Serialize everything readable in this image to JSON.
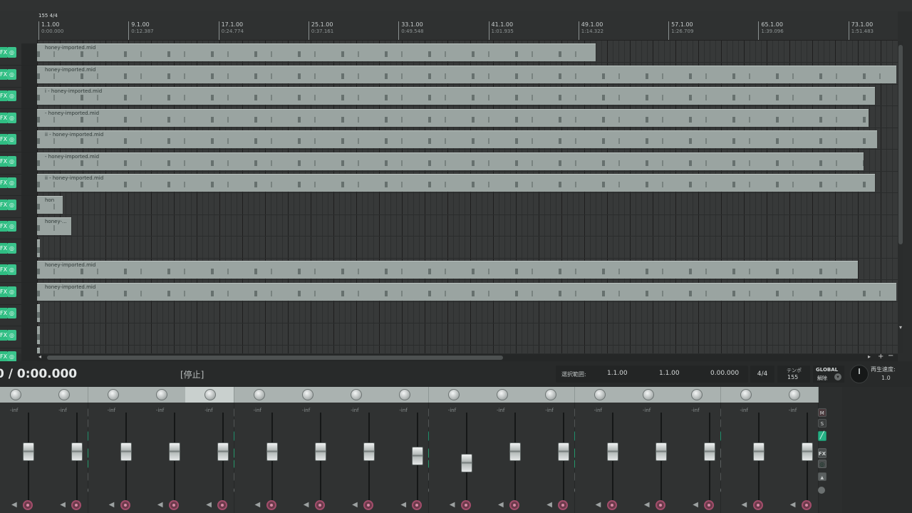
{
  "ruler": {
    "tempo_marker": "155 4/4",
    "marks": [
      {
        "bar": "1.1.00",
        "time": "0:00.000"
      },
      {
        "bar": "9.1.00",
        "time": "0:12.387"
      },
      {
        "bar": "17.1.00",
        "time": "0:24.774"
      },
      {
        "bar": "25.1.00",
        "time": "0:37.161"
      },
      {
        "bar": "33.1.00",
        "time": "0:49.548"
      },
      {
        "bar": "41.1.00",
        "time": "1:01.935"
      },
      {
        "bar": "49.1.00",
        "time": "1:14.322"
      },
      {
        "bar": "57.1.00",
        "time": "1:26.709"
      },
      {
        "bar": "65.1.00",
        "time": "1:39.096"
      },
      {
        "bar": "73.1.00",
        "time": "1:51.483"
      }
    ]
  },
  "tracks": [
    {
      "clip_label": "honey-imported.mid",
      "clip_end": 0.65
    },
    {
      "clip_label": "honey-imported.mid",
      "clip_end": 1.0
    },
    {
      "clip_label": "i - honey-imported.mid",
      "clip_end": 0.975
    },
    {
      "clip_label": "- honey-imported.mid",
      "clip_end": 0.968
    },
    {
      "clip_label": "ii - honey-imported.mid",
      "clip_end": 0.978
    },
    {
      "clip_label": "- honey-imported.mid",
      "clip_end": 0.962
    },
    {
      "clip_label": "ii - honey-imported.mid",
      "clip_end": 0.975
    },
    {
      "clip_label": "hon",
      "clip_end": 0.03
    },
    {
      "clip_label": "honey-...",
      "clip_end": 0.04
    },
    {
      "clip_label": "",
      "clip_end": 0.003
    },
    {
      "clip_label": "honey-imported.mid",
      "clip_end": 0.955
    },
    {
      "clip_label": "honey-imported.mid",
      "clip_end": 1.0
    },
    {
      "clip_label": "",
      "clip_end": 0.003
    },
    {
      "clip_label": "",
      "clip_end": 0.003
    },
    {
      "clip_label": "",
      "clip_end": 0.003
    }
  ],
  "track_controls": {
    "fx_label": "FX"
  },
  "transport": {
    "time": "0 / 0:00.000",
    "play_state": "[停止]",
    "selection_label": "選択範囲:",
    "sel_start": "1.1.00",
    "sel_end": "1.1.00",
    "sel_length": "0.00.000",
    "timesig": "4/4",
    "tempo_label": "テンポ",
    "tempo_value": "155",
    "global_label": "GLOBAL",
    "global_mode": "解除",
    "rate_label": "再生速度:",
    "rate_value": "1.0"
  },
  "scroll": {
    "left": "◂",
    "right": "▸",
    "zoom_in": "+",
    "zoom_out": "−",
    "down": "▾"
  },
  "mixer": {
    "inf_label": "-inf",
    "mute_label": "M",
    "solo_label": "S",
    "fx_label": "FX",
    "channels": [
      {
        "fader": 0.62,
        "fx_on": true,
        "selected": false
      },
      {
        "fader": 0.62,
        "fx_on": true,
        "selected": false
      },
      {
        "fader": 0.62,
        "fx_on": true,
        "selected": false
      },
      {
        "fader": 0.62,
        "fx_on": true,
        "selected": false
      },
      {
        "fader": 0.62,
        "fx_on": true,
        "selected": true
      },
      {
        "fader": 0.62,
        "fx_on": true,
        "selected": false
      },
      {
        "fader": 0.62,
        "fx_on": true,
        "selected": false
      },
      {
        "fader": 0.62,
        "fx_on": true,
        "selected": false
      },
      {
        "fader": 0.56,
        "fx_on": true,
        "selected": false
      },
      {
        "fader": 0.47,
        "fx_on": true,
        "selected": false
      },
      {
        "fader": 0.62,
        "fx_on": true,
        "selected": false
      },
      {
        "fader": 0.62,
        "fx_on": true,
        "selected": false
      },
      {
        "fader": 0.62,
        "fx_on": true,
        "selected": false
      },
      {
        "fader": 0.62,
        "fx_on": true,
        "selected": false
      },
      {
        "fader": 0.62,
        "fx_on": false,
        "selected": false
      },
      {
        "fader": 0.62,
        "fx_on": false,
        "selected": false
      },
      {
        "fader": 0.62,
        "fx_on": false,
        "selected": false
      }
    ]
  },
  "colors": {
    "clip": "#9aa4a1",
    "fx_green": "#2fbd82",
    "arm": "#a24d6b"
  }
}
